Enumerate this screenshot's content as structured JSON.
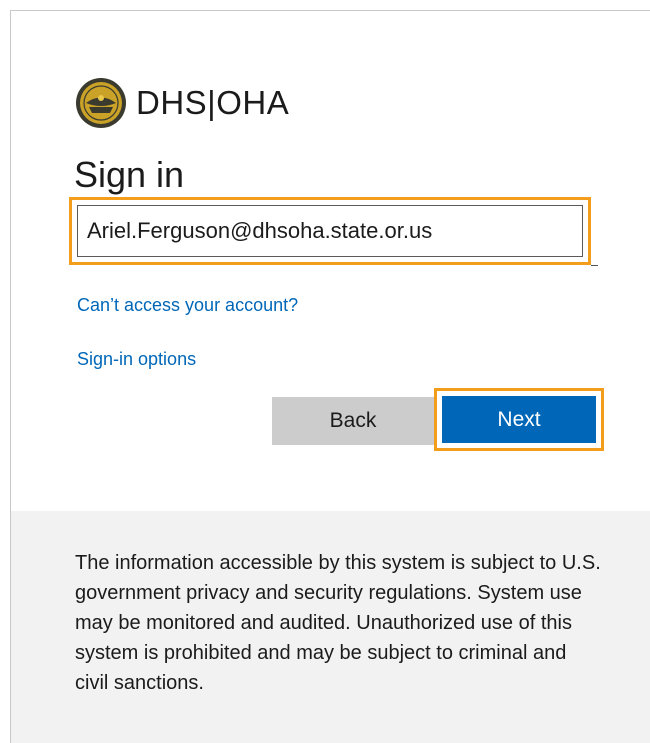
{
  "brand": {
    "name": "DHS|OHA"
  },
  "signin": {
    "title": "Sign in",
    "email_value": "Ariel.Ferguson@dhsoha.state.or.us"
  },
  "links": {
    "cant_access": "Can’t access your account?",
    "signin_options": "Sign-in options"
  },
  "buttons": {
    "back": "Back",
    "next": "Next"
  },
  "footer": {
    "notice": "The information accessible by this system is subject to U.S. government privacy and security regulations. System use may be monitored and audited. Unauthorized use of this system is prohibited and may be subject to criminal and civil sanctions."
  },
  "colors": {
    "accent_blue": "#0067b8",
    "highlight_orange": "#f29d1c",
    "back_gray": "#cccccc",
    "footer_bg": "#f2f2f2"
  }
}
